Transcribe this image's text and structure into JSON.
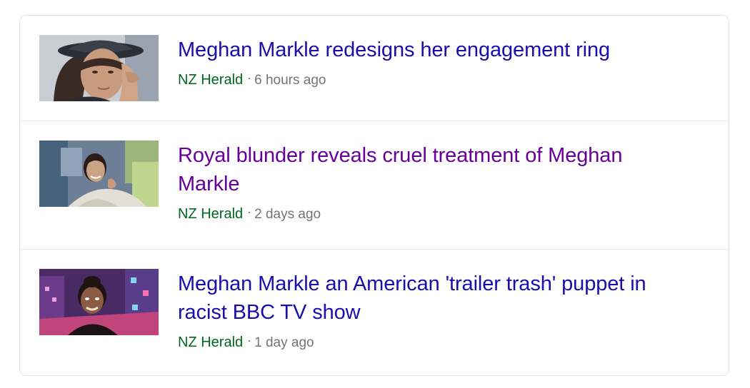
{
  "news": [
    {
      "headline": "Meghan Markle redesigns her engagement ring",
      "source": "NZ Herald",
      "separator": "·",
      "time": "6 hours ago",
      "visited": false,
      "thumbnail_icon": "woman-in-hat-photo"
    },
    {
      "headline": "Royal blunder reveals cruel treatment of Meghan Markle",
      "source": "NZ Herald",
      "separator": "·",
      "time": "2 days ago",
      "visited": true,
      "thumbnail_icon": "smiling-woman-photo"
    },
    {
      "headline": "Meghan Markle an American 'trailer trash' puppet in racist BBC TV show",
      "source": "NZ Herald",
      "separator": "·",
      "time": "1 day ago",
      "visited": false,
      "thumbnail_icon": "puppet-city-night-photo"
    }
  ],
  "colors": {
    "link_unvisited": "#1a0dab",
    "link_visited": "#660099",
    "source": "#006621",
    "meta": "#70757a",
    "border": "#dfe1e5"
  }
}
